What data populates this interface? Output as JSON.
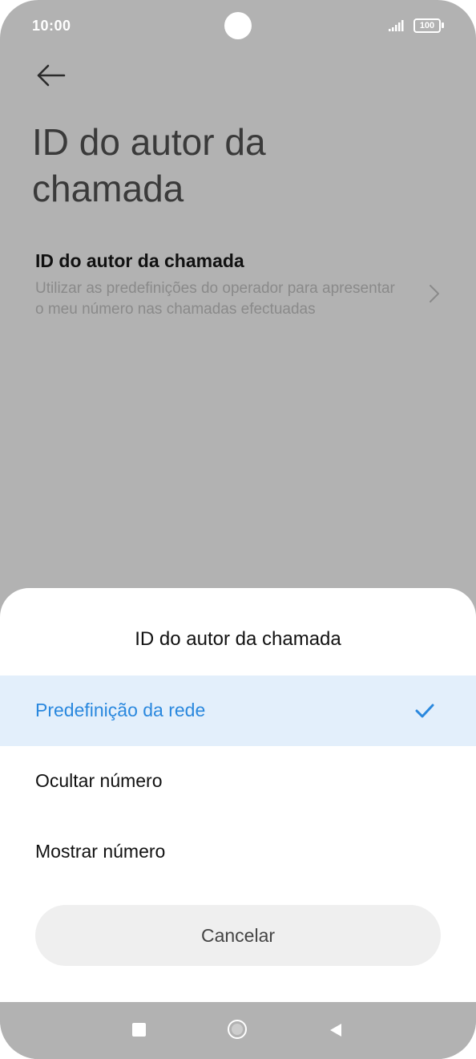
{
  "status_bar": {
    "time": "10:00",
    "battery": "100",
    "icons": [
      "signal-icon",
      "battery-icon"
    ]
  },
  "screen": {
    "back_icon": "arrow-left-icon",
    "title": "ID do autor da chamada",
    "setting": {
      "title": "ID do autor da chamada",
      "description": "Utilizar as predefinições do operador para apresentar o meu número nas chamadas efectuadas",
      "icon": "chevron-right-icon"
    }
  },
  "dialog": {
    "title": "ID do autor da chamada",
    "options": [
      {
        "label": "Predefinição da rede",
        "selected": true
      },
      {
        "label": "Ocultar número",
        "selected": false
      },
      {
        "label": "Mostrar número",
        "selected": false
      }
    ],
    "cancel_label": "Cancelar"
  },
  "nav_bar": {
    "icons": [
      "recents-icon",
      "home-icon",
      "back-icon"
    ]
  },
  "colors": {
    "accent": "#2a88de",
    "selected_bg": "#e3effb",
    "scrim": "#b2b2b2"
  }
}
